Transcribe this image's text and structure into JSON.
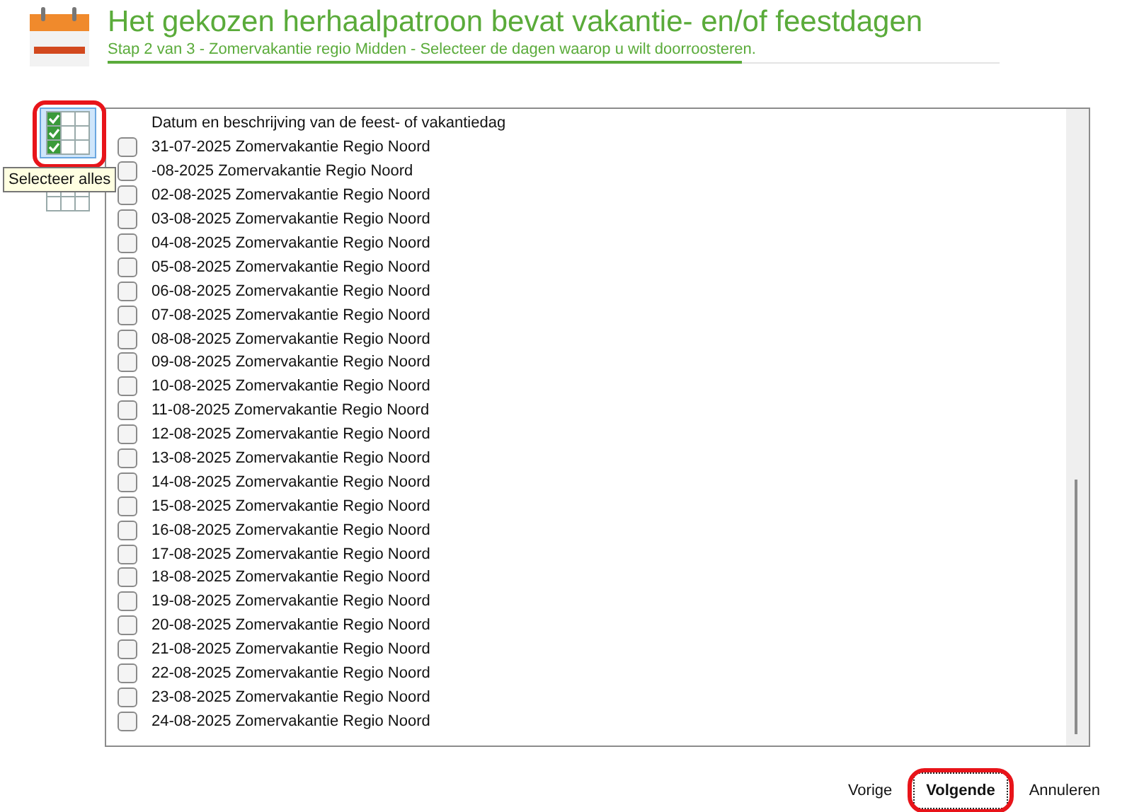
{
  "header": {
    "title": "Het gekozen herhaalpatroon bevat vakantie- en/of feestdagen",
    "subtitle": "Stap 2 van 3 - Zomervakantie regio Midden - Selecteer de dagen waarop u wilt doorroosteren."
  },
  "tools": [
    {
      "kind": "select-all",
      "selected": true,
      "highlighted": true
    },
    {
      "kind": "deselect-all",
      "selected": false,
      "highlighted": false
    }
  ],
  "tooltip": "Selecteer alles",
  "table": {
    "column_header": "Datum en beschrijving van de feest- of vakantiedag",
    "rows": [
      {
        "label": "31-07-2025 Zomervakantie Regio Noord",
        "checked": false
      },
      {
        "label": "-08-2025 Zomervakantie Regio Noord",
        "checked": false
      },
      {
        "label": "02-08-2025 Zomervakantie Regio Noord",
        "checked": false
      },
      {
        "label": "03-08-2025 Zomervakantie Regio Noord",
        "checked": false
      },
      {
        "label": "04-08-2025 Zomervakantie Regio Noord",
        "checked": false
      },
      {
        "label": "05-08-2025 Zomervakantie Regio Noord",
        "checked": false
      },
      {
        "label": "06-08-2025 Zomervakantie Regio Noord",
        "checked": false
      },
      {
        "label": "07-08-2025 Zomervakantie Regio Noord",
        "checked": false
      },
      {
        "label": "08-08-2025 Zomervakantie Regio Noord",
        "checked": false
      },
      {
        "label": "09-08-2025 Zomervakantie Regio Noord",
        "checked": false
      },
      {
        "label": "10-08-2025 Zomervakantie Regio Noord",
        "checked": false
      },
      {
        "label": "11-08-2025 Zomervakantie Regio Noord",
        "checked": false
      },
      {
        "label": "12-08-2025 Zomervakantie Regio Noord",
        "checked": false
      },
      {
        "label": "13-08-2025 Zomervakantie Regio Noord",
        "checked": false
      },
      {
        "label": "14-08-2025 Zomervakantie Regio Noord",
        "checked": false
      },
      {
        "label": "15-08-2025 Zomervakantie Regio Noord",
        "checked": false
      },
      {
        "label": "16-08-2025 Zomervakantie Regio Noord",
        "checked": false
      },
      {
        "label": "17-08-2025 Zomervakantie Regio Noord",
        "checked": false
      },
      {
        "label": "18-08-2025 Zomervakantie Regio Noord",
        "checked": false
      },
      {
        "label": "19-08-2025 Zomervakantie Regio Noord",
        "checked": false
      },
      {
        "label": "20-08-2025 Zomervakantie Regio Noord",
        "checked": false
      },
      {
        "label": "21-08-2025 Zomervakantie Regio Noord",
        "checked": false
      },
      {
        "label": "22-08-2025 Zomervakantie Regio Noord",
        "checked": false
      },
      {
        "label": "23-08-2025 Zomervakantie Regio Noord",
        "checked": false
      },
      {
        "label": "24-08-2025 Zomervakantie Regio Noord",
        "checked": false
      }
    ]
  },
  "buttons": [
    {
      "label": "Vorige",
      "default": false,
      "highlighted": false
    },
    {
      "label": "Volgende",
      "default": true,
      "highlighted": true
    },
    {
      "label": "Annuleren",
      "default": false,
      "highlighted": false
    }
  ]
}
